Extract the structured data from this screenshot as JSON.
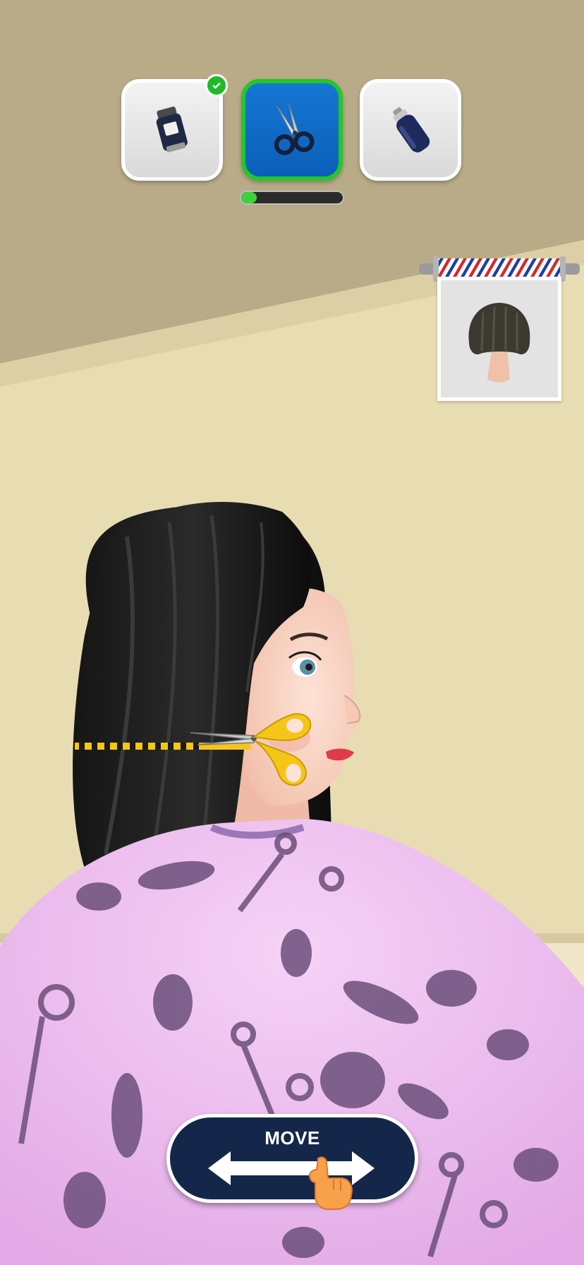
{
  "tools": [
    {
      "name": "clipper",
      "icon": "hair-clipper-icon",
      "state": "completed"
    },
    {
      "name": "scissors",
      "icon": "scissors-icon",
      "state": "active"
    },
    {
      "name": "spray",
      "icon": "spray-can-icon",
      "state": "upcoming"
    }
  ],
  "progress": 0.15,
  "reference": {
    "icon": "bob-haircut-reference-icon"
  },
  "controls": {
    "move_label": "MOVE",
    "icon": "swipe-horizontal-icon"
  },
  "colors": {
    "active_tool_bg": "#0a5fb8",
    "active_tool_border": "#22c72a",
    "check_badge": "#1fba2a",
    "progress_fill": "#3fd13a",
    "cape": "#f2c4f2",
    "button_bg": "#14274a",
    "scissors_handle": "#f5c518"
  }
}
